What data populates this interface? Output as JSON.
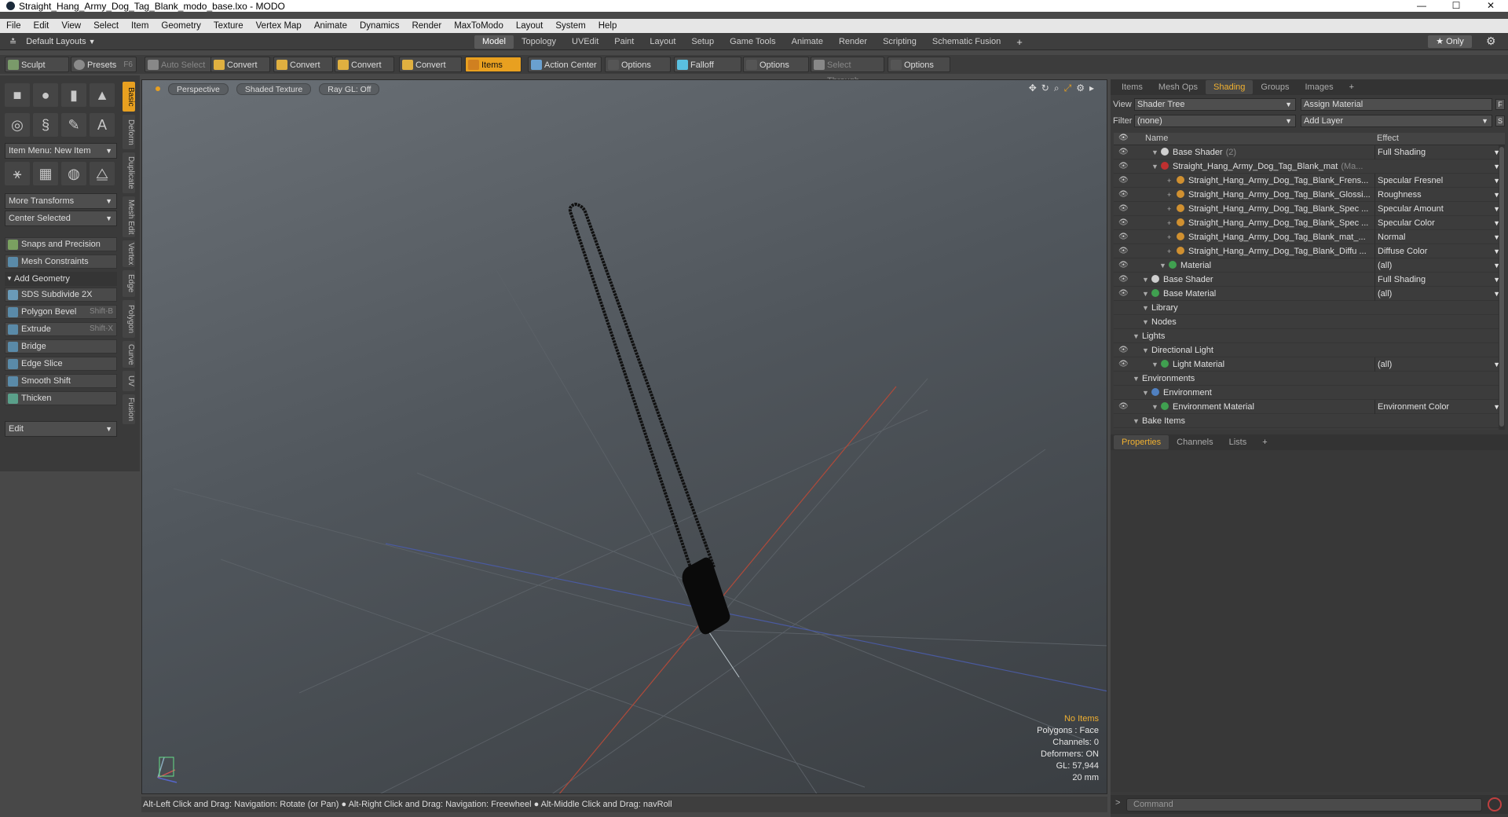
{
  "window": {
    "title": "Straight_Hang_Army_Dog_Tag_Blank_modo_base.lxo - MODO",
    "min": "—",
    "max": "☐",
    "close": "✕"
  },
  "menu": [
    "File",
    "Edit",
    "View",
    "Select",
    "Item",
    "Geometry",
    "Texture",
    "Vertex Map",
    "Animate",
    "Dynamics",
    "Render",
    "MaxToModo",
    "Layout",
    "System",
    "Help"
  ],
  "layout": {
    "name": "Default Layouts",
    "tabs": [
      "Model",
      "Topology",
      "UVEdit",
      "Paint",
      "Layout",
      "Setup",
      "Game Tools",
      "Animate",
      "Render",
      "Scripting",
      "Schematic Fusion"
    ],
    "active_tab": "Model",
    "plus": "+",
    "only": "★  Only"
  },
  "toolbar": {
    "sculpt": "Sculpt",
    "presets": "Presets",
    "presets_key": "F6",
    "items": [
      "Auto Select",
      "Convert",
      "Convert",
      "Convert",
      "Convert",
      "Items",
      "Action Center",
      "Options",
      "Falloff",
      "Options",
      "Select Through",
      "Options"
    ]
  },
  "left": {
    "item_menu": "Item Menu: New Item",
    "more_transforms": "More Transforms",
    "center_selected": "Center Selected",
    "snaps": "Snaps and Precision",
    "mesh_constraints": "Mesh Constraints",
    "add_geometry": "Add Geometry",
    "tools": [
      {
        "label": "SDS Subdivide 2X",
        "key": ""
      },
      {
        "label": "Polygon Bevel",
        "key": "Shift-B"
      },
      {
        "label": "Extrude",
        "key": "Shift-X"
      },
      {
        "label": "Bridge",
        "key": ""
      },
      {
        "label": "Edge Slice",
        "key": ""
      },
      {
        "label": "Smooth Shift",
        "key": ""
      },
      {
        "label": "Thicken",
        "key": ""
      }
    ],
    "edit": "Edit",
    "vtabs": [
      "Basic",
      "Deform",
      "Duplicate",
      "Mesh Edit",
      "Vertex",
      "Edge",
      "Polygon",
      "Curve",
      "UV",
      "Fusion"
    ]
  },
  "viewport": {
    "perspective": "Perspective",
    "shading": "Shaded Texture",
    "raygl": "Ray GL: Off",
    "info": {
      "items": "No Items",
      "polygons": "Polygons : Face",
      "channels": "Channels: 0",
      "deformers": "Deformers: ON",
      "gl": "GL: 57,944",
      "unit": "20 mm"
    }
  },
  "status": "Alt-Left Click and Drag: Navigation: Rotate (or Pan) ● Alt-Right Click and Drag: Navigation: Freewheel ● Alt-Middle Click and Drag: navRoll",
  "right": {
    "tabs": [
      "Items",
      "Mesh Ops",
      "Shading",
      "Groups",
      "Images",
      "+"
    ],
    "active_tab": "Shading",
    "view_label": "View",
    "view_value": "Shader Tree",
    "assign": "Assign Material",
    "f_btn": "F",
    "filter_label": "Filter",
    "filter_value": "(none)",
    "add_layer": "Add Layer",
    "s_btn": "S",
    "col_name": "Name",
    "col_effect": "Effect",
    "tree": [
      {
        "name": "Base Shader",
        "sub": "(2)",
        "effect": "Full Shading",
        "indent": 60,
        "eye": true,
        "ball": "#cfcfcf"
      },
      {
        "name": "Straight_Hang_Army_Dog_Tag_Blank_mat",
        "sub": "(Ma...",
        "effect": "",
        "indent": 60,
        "eye": true,
        "ball": "#c03030"
      },
      {
        "name": "Straight_Hang_Army_Dog_Tag_Blank_Frens...",
        "sub": "",
        "effect": "Specular Fresnel",
        "indent": 80,
        "eye": true,
        "ball": "#d09030"
      },
      {
        "name": "Straight_Hang_Army_Dog_Tag_Blank_Glossi...",
        "sub": "",
        "effect": "Roughness",
        "indent": 80,
        "eye": true,
        "ball": "#d09030"
      },
      {
        "name": "Straight_Hang_Army_Dog_Tag_Blank_Spec ...",
        "sub": "",
        "effect": "Specular Amount",
        "indent": 80,
        "eye": true,
        "ball": "#d09030"
      },
      {
        "name": "Straight_Hang_Army_Dog_Tag_Blank_Spec ...",
        "sub": "",
        "effect": "Specular Color",
        "indent": 80,
        "eye": true,
        "ball": "#d09030"
      },
      {
        "name": "Straight_Hang_Army_Dog_Tag_Blank_mat_...",
        "sub": "",
        "effect": "Normal",
        "indent": 80,
        "eye": true,
        "ball": "#d09030"
      },
      {
        "name": "Straight_Hang_Army_Dog_Tag_Blank_Diffu ...",
        "sub": "",
        "effect": "Diffuse Color",
        "indent": 80,
        "eye": true,
        "ball": "#d09030"
      },
      {
        "name": "Material",
        "sub": "",
        "effect": "(all)",
        "indent": 70,
        "eye": true,
        "ball": "#40a050"
      },
      {
        "name": "Base Shader",
        "sub": "",
        "effect": "Full Shading",
        "indent": 48,
        "eye": true,
        "ball": "#cfcfcf"
      },
      {
        "name": "Base Material",
        "sub": "",
        "effect": "(all)",
        "indent": 48,
        "eye": true,
        "ball": "#40a050"
      },
      {
        "name": "Library",
        "sub": "",
        "effect": "",
        "indent": 48,
        "eye": false,
        "ball": ""
      },
      {
        "name": "Nodes",
        "sub": "",
        "effect": "",
        "indent": 48,
        "eye": false,
        "ball": ""
      },
      {
        "name": "Lights",
        "sub": "",
        "effect": "",
        "indent": 36,
        "eye": false,
        "ball": ""
      },
      {
        "name": "Directional Light",
        "sub": "",
        "effect": "",
        "indent": 48,
        "eye": true,
        "ball": ""
      },
      {
        "name": "Light Material",
        "sub": "",
        "effect": "(all)",
        "indent": 60,
        "eye": true,
        "ball": "#40a050"
      },
      {
        "name": "Environments",
        "sub": "",
        "effect": "",
        "indent": 36,
        "eye": false,
        "ball": ""
      },
      {
        "name": "Environment",
        "sub": "",
        "effect": "",
        "indent": 48,
        "eye": false,
        "ball": "#5080c0"
      },
      {
        "name": "Environment Material",
        "sub": "",
        "effect": "Environment Color",
        "indent": 60,
        "eye": true,
        "ball": "#40a050"
      },
      {
        "name": "Bake Items",
        "sub": "",
        "effect": "",
        "indent": 36,
        "eye": false,
        "ball": ""
      }
    ],
    "ptabs": [
      "Properties",
      "Channels",
      "Lists",
      "+"
    ],
    "command_placeholder": "Command"
  }
}
